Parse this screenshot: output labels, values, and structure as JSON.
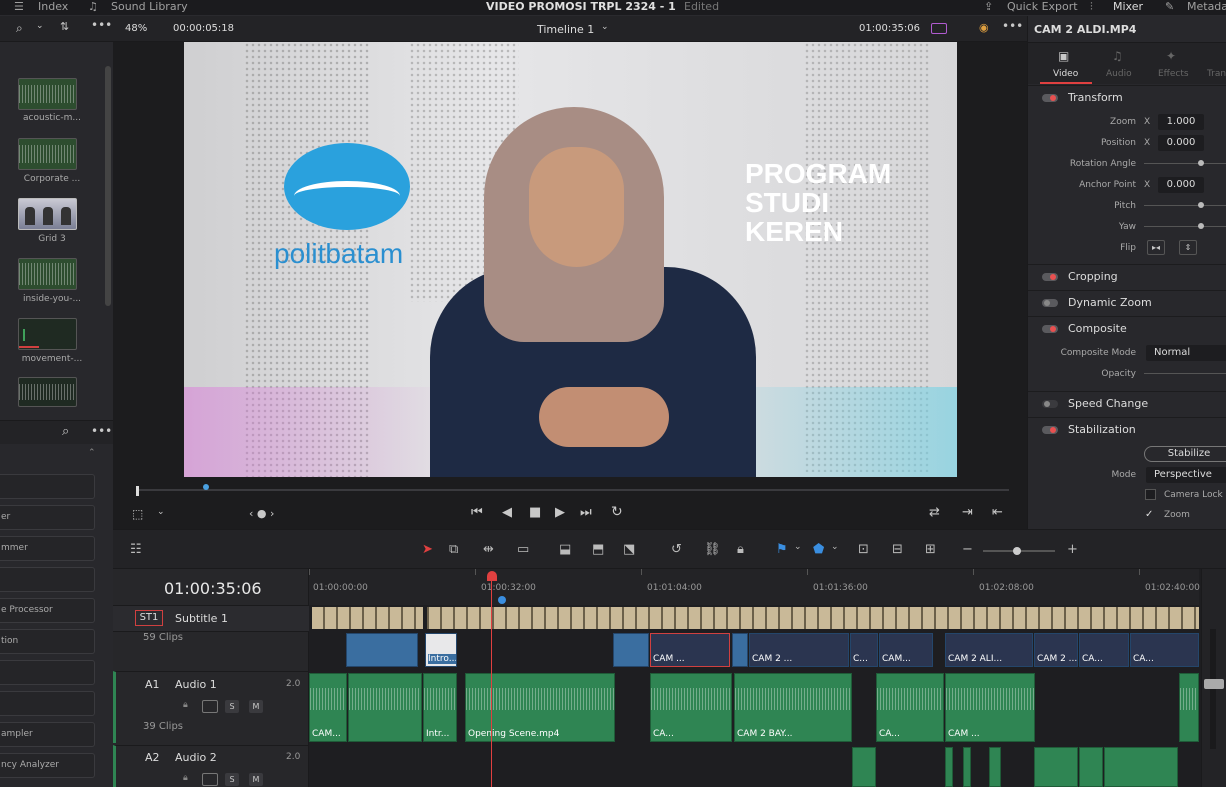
{
  "topbar": {
    "index": "Index",
    "sound_library": "Sound Library",
    "project_title": "VIDEO PROMOSI TRPL 2324 - 1",
    "edited": "Edited",
    "quick_export": "Quick Export",
    "mixer": "Mixer",
    "metadata": "Metadat"
  },
  "viewer": {
    "zoom": "48%",
    "source_tc": "00:00:05:18",
    "timeline_name": "Timeline 1",
    "record_tc": "01:00:35:06",
    "clip_logo": "politbatam",
    "overlay": [
      "PROGRAM",
      "STUDI",
      "KEREN"
    ]
  },
  "media": {
    "items": [
      {
        "label": "acoustic-m..."
      },
      {
        "label": "Corporate ..."
      },
      {
        "label": "Grid 3"
      },
      {
        "label": "inside-you-..."
      },
      {
        "label": "movement-..."
      }
    ]
  },
  "effects": {
    "items": [
      "",
      "er",
      "mmer",
      "",
      "e Processor",
      "tion",
      "",
      "",
      "ampler",
      "ncy Analyzer"
    ]
  },
  "inspector": {
    "clip_name": "CAM 2 ALDI.MP4",
    "tabs": [
      "Video",
      "Audio",
      "Effects",
      "Tran"
    ],
    "transform": "Transform",
    "zoom_label": "Zoom",
    "x_label": "X",
    "zoom_x": "1.000",
    "position_label": "Position",
    "position_x": "0.000",
    "rotation_label": "Rotation Angle",
    "anchor_label": "Anchor Point",
    "anchor_x": "0.000",
    "pitch_label": "Pitch",
    "yaw_label": "Yaw",
    "flip_label": "Flip",
    "cropping": "Cropping",
    "dynamic_zoom": "Dynamic Zoom",
    "composite": "Composite",
    "composite_mode_label": "Composite Mode",
    "composite_mode": "Normal",
    "opacity_label": "Opacity",
    "speed_change": "Speed Change",
    "stabilization": "Stabilization",
    "stabilize_btn": "Stabilize",
    "mode_label": "Mode",
    "mode_value": "Perspective",
    "camera_lock": "Camera Lock",
    "zoom_chk": "Zoom"
  },
  "timeline": {
    "timecode": "01:00:35:06",
    "ruler": [
      "01:00:00:00",
      "01:00:32:00",
      "01:01:04:00",
      "01:01:36:00",
      "01:02:08:00",
      "01:02:40:00"
    ],
    "st1": "ST1",
    "subtitle_name": "Subtitle 1",
    "video_clips": "59 Clips",
    "a1": "A1",
    "audio1": "Audio 1",
    "a1_level": "2.0",
    "audio_clips": "39 Clips",
    "a2": "A2",
    "audio2": "Audio 2",
    "a2_level": "2.0",
    "solo": "S",
    "mute": "M",
    "vclips": [
      "Intro...",
      "CAM ...",
      "CAM 2 ...",
      "C...",
      "CAM...",
      "CAM 2 ALI...",
      "CAM 2 ...",
      "CA...",
      "CA..."
    ],
    "aclips": [
      "CAM...",
      "Intr...",
      "Opening Scene.mp4",
      "CA...",
      "CAM 2 BAY...",
      "CA...",
      "CAM ..."
    ]
  }
}
